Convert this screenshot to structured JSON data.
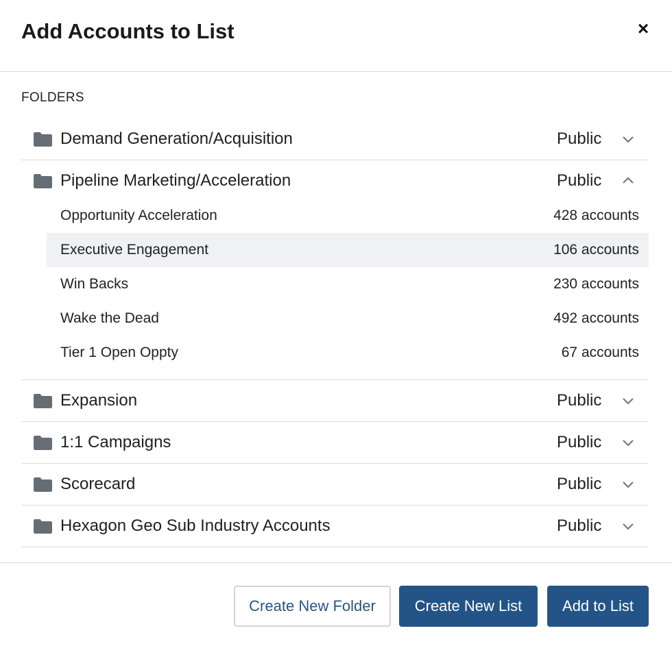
{
  "dialog": {
    "title": "Add Accounts to List",
    "close_label": "×"
  },
  "folders_label": "FOLDERS",
  "folders": [
    {
      "name": "Demand Generation/Acquisition",
      "visibility": "Public",
      "expanded": false,
      "icon": "folder-icon"
    },
    {
      "name": "Pipeline Marketing/Acceleration",
      "visibility": "Public",
      "expanded": true,
      "icon": "folder-icon",
      "lists": [
        {
          "name": "Opportunity Acceleration",
          "count": "428 accounts",
          "selected": false
        },
        {
          "name": "Executive Engagement",
          "count": "106 accounts",
          "selected": true
        },
        {
          "name": "Win Backs",
          "count": "230 accounts",
          "selected": false
        },
        {
          "name": "Wake the Dead",
          "count": "492 accounts",
          "selected": false
        },
        {
          "name": "Tier 1 Open Oppty",
          "count": "67 accounts",
          "selected": false
        }
      ]
    },
    {
      "name": "Expansion",
      "visibility": "Public",
      "expanded": false,
      "icon": "folder-icon"
    },
    {
      "name": "1:1 Campaigns",
      "visibility": "Public",
      "expanded": false,
      "icon": "folder-icon"
    },
    {
      "name": "Scorecard",
      "visibility": "Public",
      "expanded": false,
      "icon": "folder-icon"
    },
    {
      "name": "Hexagon Geo Sub Industry Accounts",
      "visibility": "Public",
      "expanded": false,
      "icon": "folder-icon"
    }
  ],
  "footer": {
    "create_folder_label": "Create New Folder",
    "create_list_label": "Create New List",
    "add_label": "Add to List"
  },
  "colors": {
    "primary": "#245487",
    "folder_icon": "#666d75",
    "chevron": "#6b7280",
    "selected_row": "#f0f1f3",
    "divider": "#dcdcdc"
  }
}
